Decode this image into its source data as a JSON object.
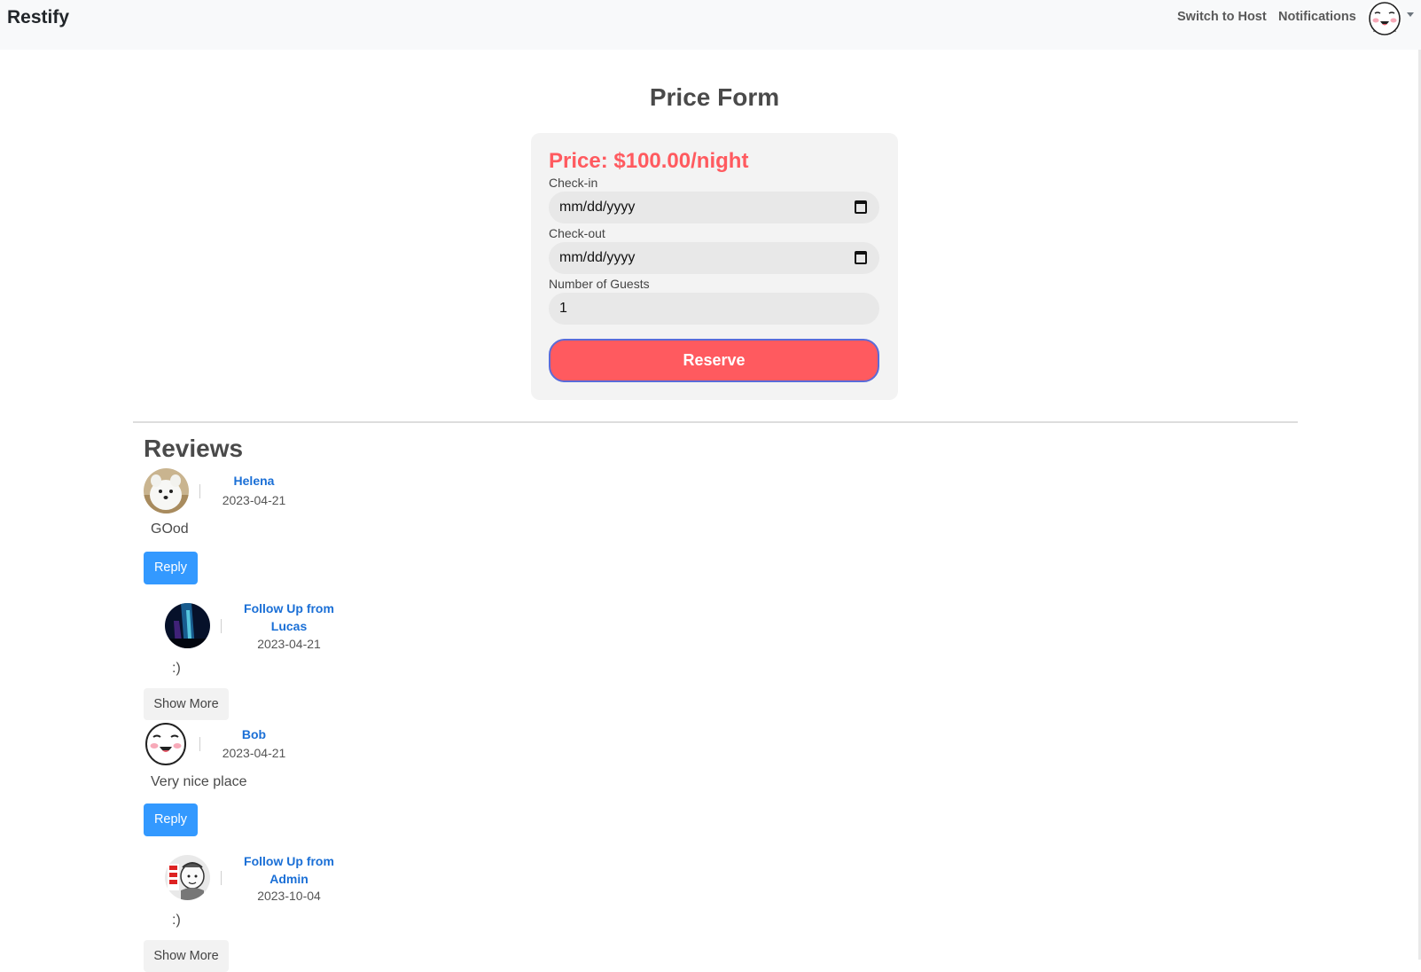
{
  "navbar": {
    "brand": "Restify",
    "switch_label": "Switch to Host",
    "notifications_label": "Notifications",
    "avatar_icon": "cartoon-face-avatar",
    "caret_icon": "caret-down-icon"
  },
  "form": {
    "title": "Price Form",
    "price": "Price: $100.00/night",
    "checkin_label": "Check-in",
    "checkin_value": "mm/dd/yyyy",
    "checkout_label": "Check-out",
    "checkout_value": "mm/dd/yyyy",
    "guests_label": "Number of Guests",
    "guests_value": "1",
    "reserve_label": "Reserve",
    "calendar_icon": "calendar-icon",
    "accent_color": "#ff5a5f"
  },
  "reviews": {
    "title": "Reviews",
    "reply_label": "Reply",
    "show_more_label": "Show More",
    "items": [
      {
        "author": "Helena",
        "date": "2023-04-21",
        "comment": "GOod",
        "avatar_icon": "white-dog-avatar",
        "followup": {
          "author": "Follow Up from Lucas",
          "date": "2023-04-21",
          "comment": ":)",
          "avatar_icon": "night-sky-avatar"
        }
      },
      {
        "author": "Bob",
        "date": "2023-04-21",
        "comment": "Very nice place",
        "avatar_icon": "cartoon-face-avatar",
        "followup": {
          "author": "Follow Up from Admin",
          "date": "2023-10-04",
          "comment": ":)",
          "avatar_icon": "meme-sketch-avatar"
        }
      }
    ]
  },
  "colors": {
    "link": "#1a6fd6",
    "reply_button": "#3399ff",
    "reserve_border": "#5a6bd8"
  }
}
